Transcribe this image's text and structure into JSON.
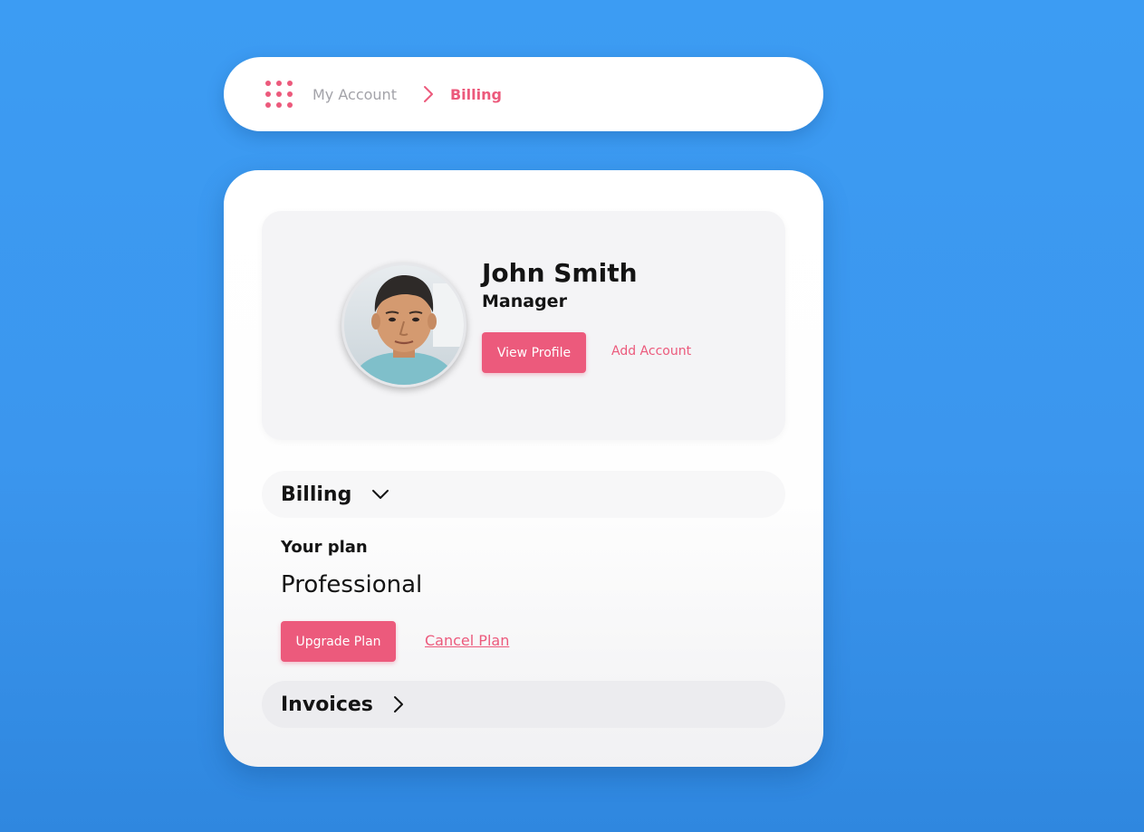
{
  "breadcrumb": {
    "menu_icon": "grid-dots-icon",
    "parent_label": "My Account",
    "separator_icon": "chevron-right-icon",
    "current_label": "Billing"
  },
  "profile": {
    "name": "John Smith",
    "role": "Manager",
    "avatar_icon": "user-photo",
    "view_profile_label": "View Profile",
    "add_account_label": "Add Account"
  },
  "billing": {
    "section_title": "Billing",
    "expand_icon": "chevron-down-icon",
    "plan_label": "Your plan",
    "plan_name": "Professional",
    "upgrade_label": "Upgrade Plan",
    "cancel_label": "Cancel Plan"
  },
  "invoices": {
    "section_title": "Invoices",
    "expand_icon": "chevron-right-icon"
  },
  "colors": {
    "accent": "#ec5a7c",
    "background": "#3c9cf3",
    "text": "#141414",
    "muted": "#a3a3a9"
  }
}
